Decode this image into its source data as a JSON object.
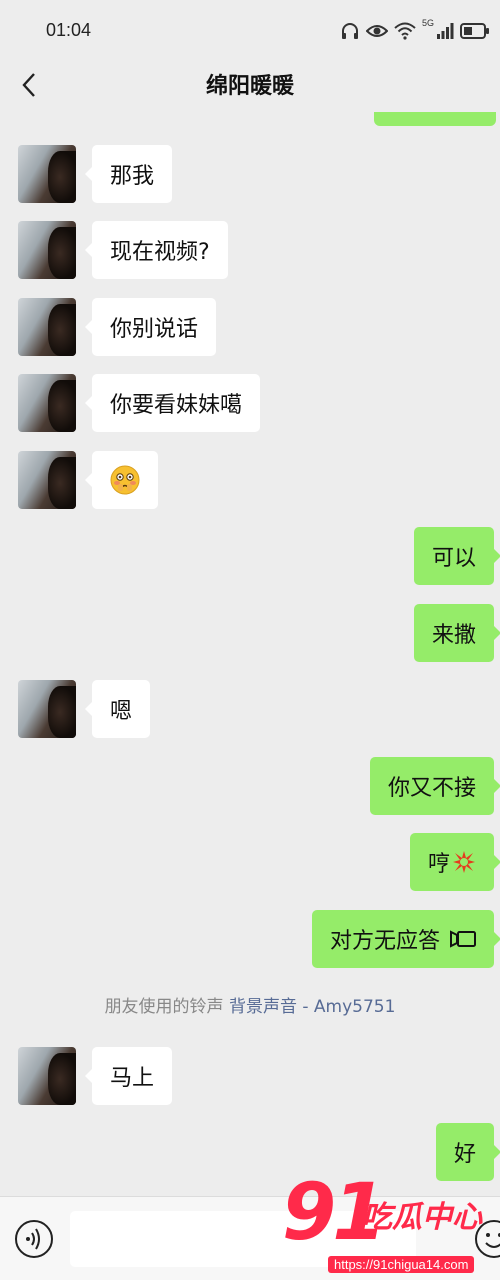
{
  "status": {
    "time": "01:04",
    "network": "5G"
  },
  "header": {
    "title": "绵阳暖暖"
  },
  "messages": [
    {
      "side": "in",
      "text": "那我"
    },
    {
      "side": "in",
      "text": "现在视频?"
    },
    {
      "side": "in",
      "text": "你别说话"
    },
    {
      "side": "in",
      "text": "你要看妹妹噶"
    },
    {
      "side": "in",
      "icon": "flushed-face-emoji"
    },
    {
      "side": "out",
      "text": "可以"
    },
    {
      "side": "out",
      "text": "来撒"
    },
    {
      "side": "in",
      "text": "嗯"
    },
    {
      "side": "out",
      "text": "你又不接"
    },
    {
      "side": "out",
      "text": "哼",
      "icon": "angry-emoji"
    },
    {
      "side": "out",
      "text": "对方无应答",
      "icon": "video-call-icon"
    },
    {
      "side": "in",
      "text": "马上"
    },
    {
      "side": "out",
      "text": "好"
    }
  ],
  "system_note": {
    "prefix": "朋友使用的铃声 ",
    "link": "背景声音 - Amy5751"
  },
  "watermark": {
    "number": "91",
    "text": "吃瓜中心",
    "url": "https://91chigua14.com"
  },
  "colors": {
    "background": "#ededed",
    "out_bubble": "#95ec69",
    "in_bubble": "#ffffff",
    "link": "#576b95",
    "watermark": "#ff2a4a"
  }
}
